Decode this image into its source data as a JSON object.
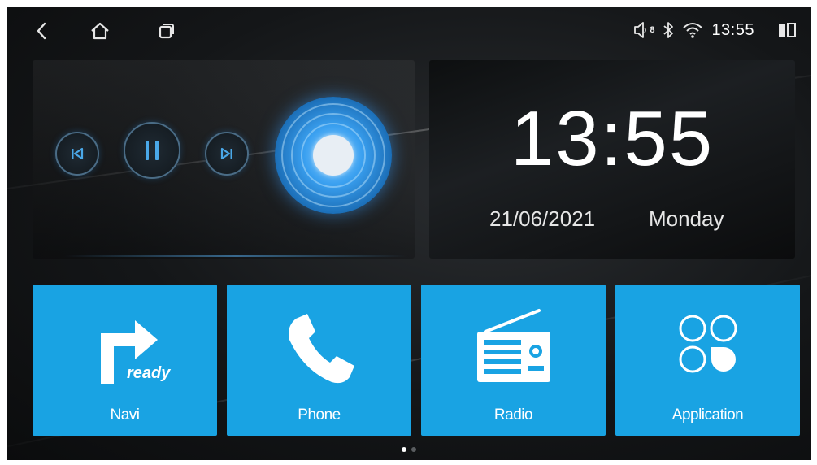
{
  "status_bar": {
    "volume_level": "8",
    "time": "13:55",
    "icons": [
      "back-icon",
      "home-icon",
      "recent-apps-icon",
      "volume-icon",
      "bluetooth-icon",
      "wifi-icon",
      "split-screen-icon"
    ]
  },
  "music": {
    "controls": [
      "previous-icon",
      "pause-icon",
      "next-icon"
    ]
  },
  "clock": {
    "time": "13:55",
    "date": "21/06/2021",
    "day": "Monday"
  },
  "tiles": [
    {
      "label": "Navi",
      "icon": "navigation-arrow-icon",
      "badge": "ready"
    },
    {
      "label": "Phone",
      "icon": "phone-icon"
    },
    {
      "label": "Radio",
      "icon": "radio-icon"
    },
    {
      "label": "Application",
      "icon": "apps-grid-icon"
    }
  ],
  "pager": {
    "active_page": 1,
    "page_count": 2
  },
  "colors": {
    "tile_blue": "#19a3e3",
    "background": "#141618",
    "accent": "#3aa0f0"
  }
}
